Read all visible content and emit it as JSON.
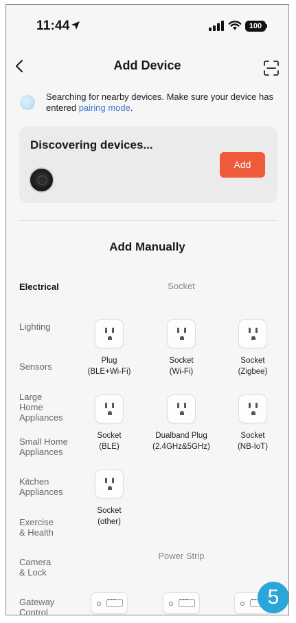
{
  "status_bar": {
    "time": "11:44",
    "battery": "100"
  },
  "nav": {
    "title": "Add Device"
  },
  "searching": {
    "text": "Searching for nearby devices. Make sure your device has entered ",
    "link": "pairing mode",
    "suffix": "."
  },
  "discover": {
    "title": "Discovering devices...",
    "add_label": "Add"
  },
  "manual": {
    "title": "Add Manually"
  },
  "categories": [
    {
      "label": "Electrical"
    },
    {
      "label": "Lighting"
    },
    {
      "label": "Sensors"
    },
    {
      "label": "Large Home Appliances"
    },
    {
      "label": "Small Home Appliances"
    },
    {
      "label": "Kitchen Appliances"
    },
    {
      "label": "Exercise & Health"
    },
    {
      "label": "Camera & Lock"
    },
    {
      "label": "Gateway Control"
    }
  ],
  "groups": {
    "socket": {
      "header": "Socket",
      "items": [
        {
          "name": "Plug",
          "sub": "(BLE+Wi-Fi)"
        },
        {
          "name": "Socket",
          "sub": "(Wi-Fi)"
        },
        {
          "name": "Socket",
          "sub": "(Zigbee)"
        },
        {
          "name": "Socket",
          "sub": "(BLE)"
        },
        {
          "name": "Dualband Plug",
          "sub": "(2.4GHz&5GHz)"
        },
        {
          "name": "Socket",
          "sub": "(NB-IoT)"
        },
        {
          "name": "Socket",
          "sub": "(other)"
        }
      ]
    },
    "strip": {
      "header": "Power Strip"
    }
  },
  "step_badge": "5",
  "colors": {
    "accent": "#ee5a3a",
    "link": "#3a7bd5",
    "badge": "#2aa6d8"
  }
}
